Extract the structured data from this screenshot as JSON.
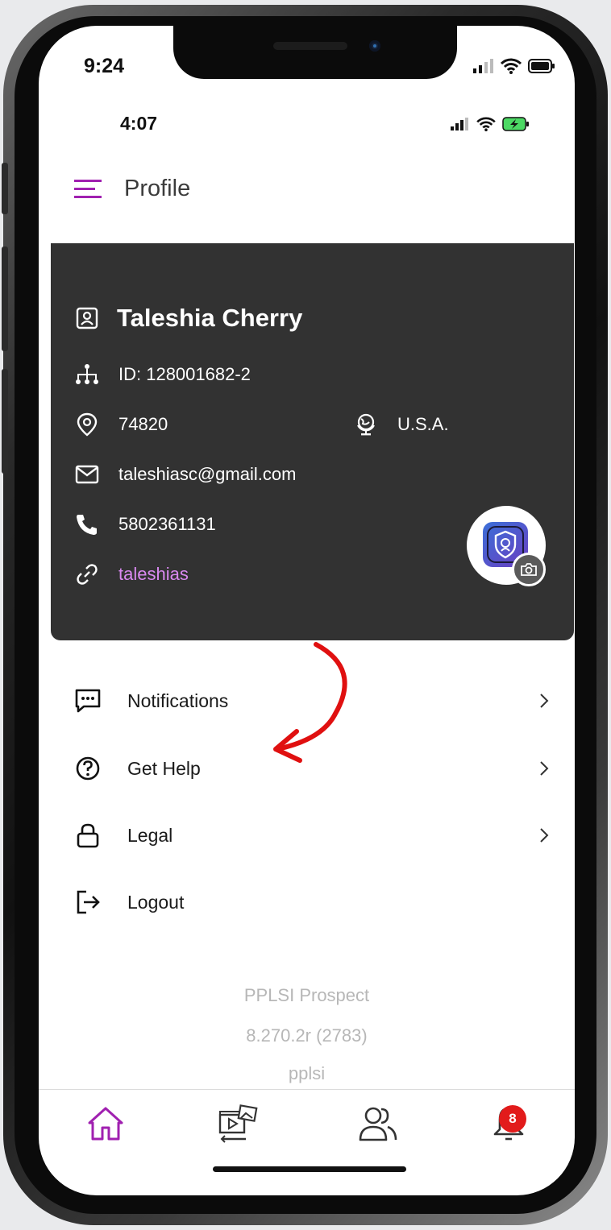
{
  "status_bar": {
    "time": "9:24"
  },
  "app_status_bar": {
    "time": "4:07"
  },
  "header": {
    "title": "Profile",
    "accent": "#a020b0"
  },
  "profile": {
    "name": "Taleshia Cherry",
    "id": "ID: 128001682-2",
    "zip": "74820",
    "country": "U.S.A.",
    "email": "taleshiasc@gmail.com",
    "phone": "5802361131",
    "username": "taleshias",
    "card_color": "#323232",
    "link_color": "#d989f0"
  },
  "menu": {
    "notifications": "Notifications",
    "get_help": "Get Help",
    "legal": "Legal",
    "logout": "Logout"
  },
  "footer": {
    "app_name": "PPLSI Prospect",
    "version": "8.270.2r (2783)",
    "company": "pplsi"
  },
  "tabbar": {
    "items": [
      "home-icon",
      "media-icon",
      "people-icon",
      "bell-icon"
    ],
    "active_color": "#a020b0",
    "notification_badge": "8",
    "badge_color": "#e21b1b"
  },
  "annotation": {
    "arrow_color": "#e01010"
  }
}
